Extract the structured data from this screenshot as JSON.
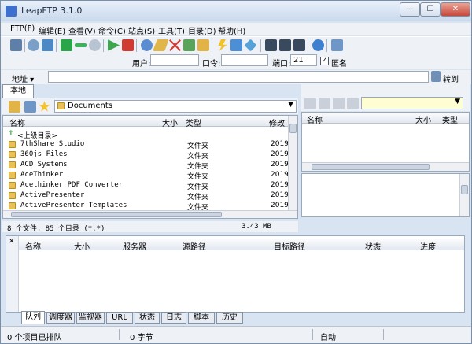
{
  "window": {
    "title": "LeapFTP 3.1.0"
  },
  "menu": [
    "FTP(F)",
    "编辑(E)",
    "查看(V)",
    "命令(C)",
    "站点(S)",
    "工具(T)",
    "目录(D)",
    "帮助(H)"
  ],
  "login": {
    "user_label": "用户:",
    "user_value": "",
    "pass_label": "口令:",
    "pass_value": "",
    "port_label": "端口:",
    "port_value": "21",
    "anon_label": "匿名",
    "anon_checked": "✓"
  },
  "address": {
    "label": "地址",
    "value": "",
    "go_label": "转到"
  },
  "local": {
    "tab_label": "本地",
    "path": "Documents",
    "columns": {
      "name": "名称",
      "size": "大小",
      "type": "类型",
      "modified": "修改"
    },
    "rows": [
      {
        "name": "<上级目录>",
        "type": "",
        "date": ""
      },
      {
        "name": "7thShare Studio",
        "type": "文件夹",
        "date": "2019"
      },
      {
        "name": "360js Files",
        "type": "文件夹",
        "date": "2019"
      },
      {
        "name": "ACD Systems",
        "type": "文件夹",
        "date": "2019"
      },
      {
        "name": "AceThinker",
        "type": "文件夹",
        "date": "2019"
      },
      {
        "name": "Acethinker PDF Converter",
        "type": "文件夹",
        "date": "2019"
      },
      {
        "name": "ActivePresenter",
        "type": "文件夹",
        "date": "2019"
      },
      {
        "name": "ActivePresenter Templates",
        "type": "文件夹",
        "date": "2019"
      }
    ],
    "footer_count": "8 个文件, 85 个目录 (*.*)",
    "footer_size": "3.43 MB"
  },
  "remote": {
    "columns": {
      "name": "名称",
      "size": "大小",
      "type": "类型"
    }
  },
  "queue": {
    "columns": [
      "名称",
      "大小",
      "服务器",
      "源路径",
      "目标路径",
      "状态",
      "进度"
    ],
    "tabs": [
      "队列",
      "调度器",
      "监视器",
      "URL",
      "状态",
      "日志",
      "脚本",
      "历史"
    ]
  },
  "status": {
    "items_text": "0 个项目已排队",
    "bytes_text": "0 字节",
    "mode_text": "自动"
  }
}
